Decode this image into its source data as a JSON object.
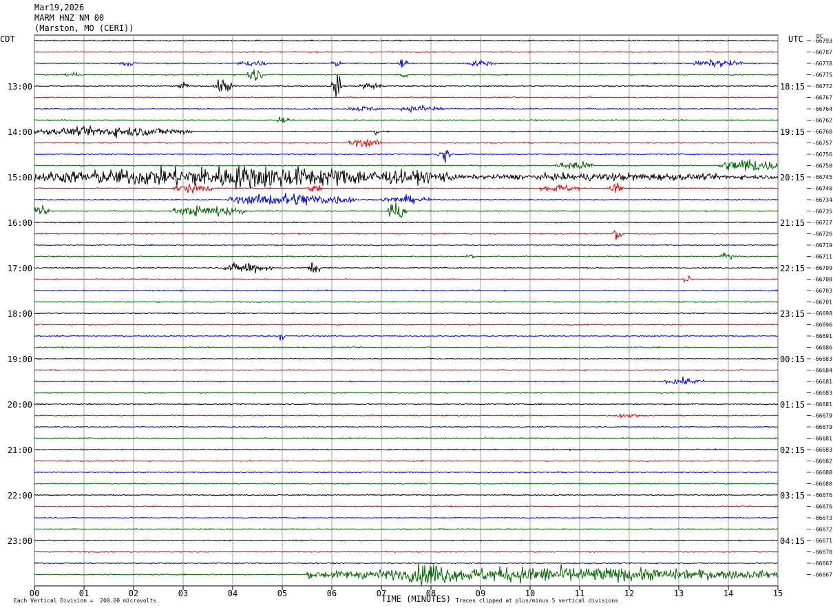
{
  "header": {
    "date": "Mar19,2026",
    "station": "MARM HNZ NM 00",
    "location": "(Marston, MO (CERI))"
  },
  "left_zone_label": "CDT",
  "right_zone_label": "UTC",
  "right_column_label": "DC",
  "footer": {
    "scale_note": "Each Vertical Division =  200.00 microvolts",
    "axis_title": "TIME (MINUTES)",
    "clip_note": "Traces clipped at plus/minus 5 vertical divisions"
  },
  "colors": {
    "cycle": [
      "#000000",
      "#e00000",
      "#0000e0",
      "#006400"
    ],
    "grid": "#888888"
  },
  "chart_data": {
    "type": "line",
    "title": "",
    "xlabel": "TIME (MINUTES)",
    "ylabel": "",
    "xlim": [
      0,
      15
    ],
    "x_ticks": [
      "00",
      "01",
      "02",
      "03",
      "04",
      "05",
      "06",
      "07",
      "08",
      "09",
      "10",
      "11",
      "12",
      "13",
      "14",
      "15"
    ],
    "trace_count": 48,
    "traces_per_hour": 4,
    "left_hour_labels": [
      "13:00",
      "14:00",
      "15:00",
      "16:00",
      "17:00",
      "18:00",
      "19:00",
      "20:00",
      "21:00",
      "22:00",
      "23:00"
    ],
    "right_hour_labels": [
      "18:15",
      "19:15",
      "20:15",
      "21:15",
      "22:15",
      "23:15",
      "00:15",
      "01:15",
      "02:15",
      "03:15",
      "04:15"
    ],
    "hour_label_first_trace": 4,
    "dc_offsets": [
      "-66793",
      "-66787",
      "-66778",
      "-66775",
      "-66772",
      "-66767",
      "-66764",
      "-66762",
      "-66760",
      "-66757",
      "-66756",
      "-66750",
      "-66745",
      "-66740",
      "-66734",
      "-66735",
      "-66727",
      "-66726",
      "-66719",
      "-66711",
      "-66709",
      "-66708",
      "-66703",
      "-66701",
      "-66698",
      "-66696",
      "-66691",
      "-66686",
      "-66683",
      "-66684",
      "-66681",
      "-66683",
      "-66681",
      "-66679",
      "-66679",
      "-66681",
      "-66683",
      "-66682",
      "-66680",
      "-66680",
      "-66676",
      "-66676",
      "-66673",
      "-66672",
      "-66671",
      "-66670",
      "-66667",
      "-66667"
    ],
    "noise_level": 0.06,
    "events": [
      {
        "trace": 2,
        "start": 1.7,
        "end": 2.1,
        "amp": 0.35
      },
      {
        "trace": 2,
        "start": 4.1,
        "end": 4.7,
        "amp": 0.4
      },
      {
        "trace": 2,
        "start": 6.0,
        "end": 6.2,
        "amp": 0.4
      },
      {
        "trace": 2,
        "start": 7.35,
        "end": 7.55,
        "amp": 0.9
      },
      {
        "trace": 2,
        "start": 8.7,
        "end": 9.3,
        "amp": 0.35
      },
      {
        "trace": 2,
        "start": 13.3,
        "end": 14.3,
        "amp": 0.45
      },
      {
        "trace": 3,
        "start": 0.6,
        "end": 0.9,
        "amp": 0.4
      },
      {
        "trace": 3,
        "start": 4.3,
        "end": 4.6,
        "amp": 0.8
      },
      {
        "trace": 3,
        "start": 7.35,
        "end": 7.55,
        "amp": 0.5
      },
      {
        "trace": 4,
        "start": 2.9,
        "end": 3.1,
        "amp": 0.5
      },
      {
        "trace": 4,
        "start": 3.6,
        "end": 4.0,
        "amp": 0.8
      },
      {
        "trace": 4,
        "start": 6.0,
        "end": 6.2,
        "amp": 1.4
      },
      {
        "trace": 4,
        "start": 6.5,
        "end": 7.0,
        "amp": 0.4
      },
      {
        "trace": 6,
        "start": 6.3,
        "end": 7.0,
        "amp": 0.35
      },
      {
        "trace": 6,
        "start": 7.4,
        "end": 8.3,
        "amp": 0.45
      },
      {
        "trace": 7,
        "start": 4.9,
        "end": 5.2,
        "amp": 0.5
      },
      {
        "trace": 8,
        "start": 0.0,
        "end": 3.2,
        "amp": 0.6
      },
      {
        "trace": 8,
        "start": 6.85,
        "end": 6.95,
        "amp": 0.5
      },
      {
        "trace": 9,
        "start": 6.3,
        "end": 7.0,
        "amp": 0.5
      },
      {
        "trace": 10,
        "start": 8.1,
        "end": 8.4,
        "amp": 0.9
      },
      {
        "trace": 11,
        "start": 10.5,
        "end": 11.3,
        "amp": 0.6
      },
      {
        "trace": 11,
        "start": 13.8,
        "end": 15.0,
        "amp": 0.9
      },
      {
        "trace": 12,
        "start": 0.0,
        "end": 8.5,
        "amp": 1.3
      },
      {
        "trace": 12,
        "start": 8.5,
        "end": 15.0,
        "amp": 0.45
      },
      {
        "trace": 13,
        "start": 2.8,
        "end": 3.6,
        "amp": 0.6
      },
      {
        "trace": 13,
        "start": 5.5,
        "end": 5.8,
        "amp": 0.7
      },
      {
        "trace": 13,
        "start": 10.2,
        "end": 11.0,
        "amp": 0.5
      },
      {
        "trace": 13,
        "start": 11.6,
        "end": 11.9,
        "amp": 0.8
      },
      {
        "trace": 14,
        "start": 3.9,
        "end": 6.5,
        "amp": 0.8
      },
      {
        "trace": 14,
        "start": 7.0,
        "end": 8.0,
        "amp": 0.45
      },
      {
        "trace": 15,
        "start": 0.0,
        "end": 0.3,
        "amp": 0.8
      },
      {
        "trace": 15,
        "start": 2.8,
        "end": 4.3,
        "amp": 0.7
      },
      {
        "trace": 15,
        "start": 7.1,
        "end": 7.5,
        "amp": 1.3
      },
      {
        "trace": 17,
        "start": 11.65,
        "end": 11.85,
        "amp": 1.2
      },
      {
        "trace": 19,
        "start": 8.7,
        "end": 8.9,
        "amp": 0.5
      },
      {
        "trace": 19,
        "start": 13.8,
        "end": 14.1,
        "amp": 0.7
      },
      {
        "trace": 20,
        "start": 3.8,
        "end": 4.8,
        "amp": 0.7
      },
      {
        "trace": 20,
        "start": 5.5,
        "end": 5.8,
        "amp": 0.7
      },
      {
        "trace": 21,
        "start": 13.1,
        "end": 13.3,
        "amp": 0.7
      },
      {
        "trace": 26,
        "start": 4.9,
        "end": 5.05,
        "amp": 0.6
      },
      {
        "trace": 30,
        "start": 12.7,
        "end": 13.5,
        "amp": 0.4
      },
      {
        "trace": 33,
        "start": 11.7,
        "end": 12.2,
        "amp": 0.3
      },
      {
        "trace": 47,
        "start": 5.5,
        "end": 15.0,
        "amp": 0.9
      },
      {
        "trace": 47,
        "start": 7.5,
        "end": 8.5,
        "amp": 1.5
      }
    ]
  }
}
